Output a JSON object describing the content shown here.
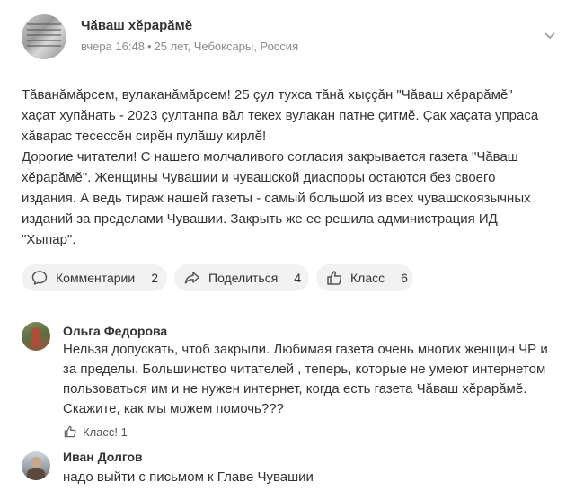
{
  "post": {
    "author": "Чăваш хĕрарăмĕ",
    "time": "вчера 16:48",
    "age": "25 лет, Чебоксары, Россия",
    "text_lines": [
      "Тăванăмăрсем, вулаканăмăрсем! 25 çул тухса тăнă хыççăн \"Чăваш хĕрарăмĕ\"",
      "хаçат хупăнать - 2023 çултанпа вăл текех вулакан патне çитмĕ. Çак хаçата упраса",
      "хăварас тесессĕн сирĕн пулăшу кирлĕ!",
      "Дорогие читатели! С нашего молчаливого согласия закрывается газета \"Чăваш",
      "хĕрарăмĕ\". Женщины Чувашии и чувашской диаспоры остаются без своего",
      "издания. А ведь тираж нашей газеты - самый большой из всех чувашскоязычных",
      "изданий за пределами Чувашии. Закрыть же ее решила администрация ИД",
      "\"Хыпар\"."
    ]
  },
  "actions": {
    "comments": {
      "label": "Комментарии",
      "count": "2"
    },
    "share": {
      "label": "Поделиться",
      "count": "4"
    },
    "like": {
      "label": "Класс",
      "count": "6"
    }
  },
  "comments": [
    {
      "name": "Ольга Федорова",
      "text_lines": [
        "Нельзя допускать, чтоб закрыли. Любимая газета очень многих женщин ЧР и",
        "за пределы. Большинство читателей , теперь, которые не умеют интернетом",
        "пользоваться им и не нужен интернет, когда есть газета Чăваш хĕрарăмĕ.",
        "Скажите, как мы можем помочь???"
      ],
      "like": "Класс! 1"
    },
    {
      "name": "Иван Долгов",
      "text_lines": [
        "надо выйти с письмом к Главе Чувашии"
      ]
    }
  ],
  "colors": {
    "muted": "#8a8a8a",
    "pill_bg": "#f2f2f2",
    "text": "#333333"
  }
}
